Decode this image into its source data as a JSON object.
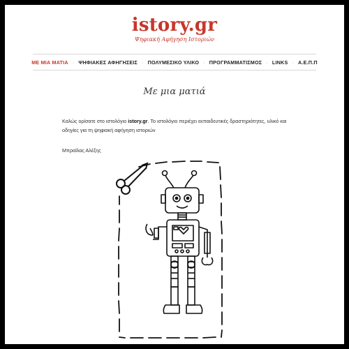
{
  "site": {
    "title": "istory.gr",
    "tagline": "Ψηφιακή Αφήγηση Ιστοριών"
  },
  "nav": {
    "items": [
      {
        "label": "ΜΕ ΜΙΑ ΜΑΤΙΑ",
        "active": true
      },
      {
        "label": "ΨΗΦΙΑΚΕΣ ΑΦΗΓΗΣΕΙΣ",
        "active": false
      },
      {
        "label": "ΠΟΛΥΜΕΣΙΚΟ ΥΛΙΚΟ",
        "active": false
      },
      {
        "label": "ΠΡΟΓΡΑΜΜΑΤΙΣΜΟΣ",
        "active": false
      },
      {
        "label": "LINKS",
        "active": false
      },
      {
        "label": "Α.Ε.Π.Π",
        "active": false
      }
    ],
    "separator": "·"
  },
  "page": {
    "title": "Με μια ματιά",
    "intro_prefix": "Καλώς ορίσατε στο ιστολόγιο ",
    "intro_site": "istory.gr",
    "intro_suffix": ". Το ιστολόγιο περιέχει εκπαιδευτικές δραστηριότητες, υλικό και οδηγίες για τη ψηφιακή αφήγηση ιστοριών",
    "signature": "Μπραϊλας Αλέξης"
  },
  "colors": {
    "brand": "#c7372a",
    "frame": "#000000",
    "text": "#333333"
  },
  "illustration": "robot-with-scissors-cutout"
}
